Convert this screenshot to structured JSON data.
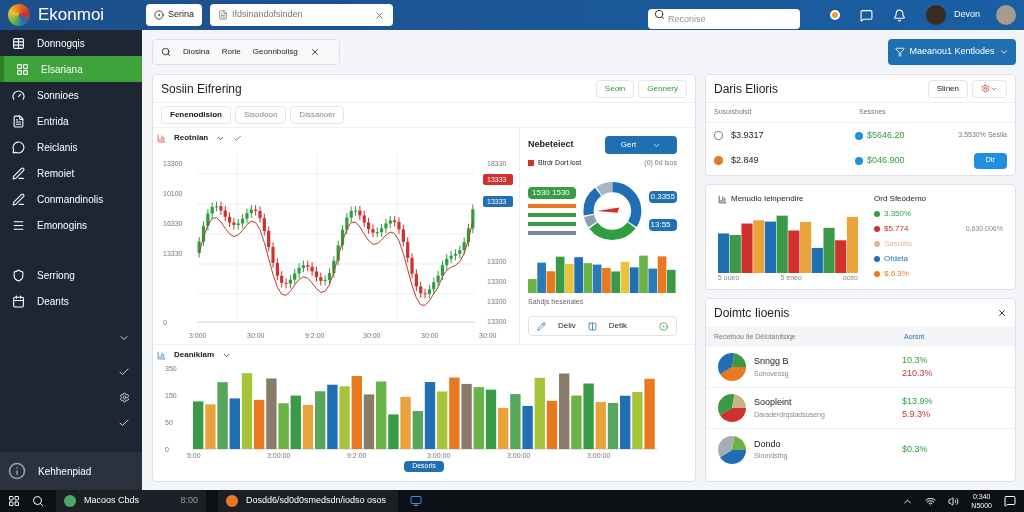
{
  "topbar": {
    "app_name": "Ekonmoi",
    "tab": "Serina",
    "field_value": "Ifdsinandofsinden",
    "search": {
      "placeholder": "Reconise"
    },
    "user": "Devon"
  },
  "sidebar": {
    "items": [
      {
        "label": "Donnogqis",
        "selected": false
      },
      {
        "label": "Elsariana",
        "selected": true
      },
      {
        "label": "Sonnioes",
        "selected": false
      },
      {
        "label": "Entrida",
        "selected": false
      },
      {
        "label": "Reiclanis",
        "selected": false
      },
      {
        "label": "Remoiet",
        "selected": false
      },
      {
        "label": "Conmandinolis",
        "selected": false
      },
      {
        "label": "Emonogins",
        "selected": false
      }
    ],
    "more_items": [
      {
        "label": "Serriong",
        "selected": false
      },
      {
        "label": "Deants",
        "selected": false
      }
    ],
    "footer": "Kehhenpiad"
  },
  "filter_bar": {
    "chips": [
      "Diosina",
      "Rorie",
      "Geonnbolisg"
    ]
  },
  "primary_button": "Maeanou1 Kentlodes",
  "main_card": {
    "title": "Sosiin Eifrering",
    "actions": [
      "Seoin",
      "Gennery"
    ],
    "tabs": [
      {
        "label": "Fenenodision",
        "selected": true
      },
      {
        "label": "Sisodoon",
        "selected": false
      },
      {
        "label": "Dissanoer",
        "selected": false
      }
    ],
    "price_chart": {
      "title": "Reotnlan",
      "left_ticks": [
        "13300",
        "10100",
        "16330",
        "13330",
        "0"
      ],
      "right_ticks": [
        "18330",
        "13300",
        "13300",
        "13300",
        "13300"
      ],
      "tags": [
        "13333",
        "13333"
      ],
      "x_labels": [
        "3:000",
        "30:00",
        "9:2:00",
        "30:00",
        "30:00",
        "30:00"
      ]
    },
    "side_panel": {
      "title": "Nebeteiect",
      "dropdown": "Gert",
      "legend": "Btrdr Dort lost",
      "legend_note": "(0) 0d lsos",
      "pill": "1530 1530",
      "donut_tags": [
        "0.3355",
        "13:55"
      ],
      "axis_note": "Sahdjs besenales",
      "tools": [
        "Deliv",
        "Detik"
      ]
    },
    "volume_chart": {
      "title": "Deaniklam",
      "y_ticks": [
        "350",
        "150",
        "50",
        "0"
      ],
      "x_labels": [
        "5:00",
        "3:00:00",
        "9:2:00",
        "3:00:00",
        "3:00:00",
        "3:00:00"
      ],
      "pill": "Desoris"
    }
  },
  "accounts_card": {
    "title": "Daris Elioris",
    "action": "Slinen",
    "columns": [
      "Susoisbolsit",
      "Sessnes"
    ],
    "rows": [
      {
        "checked": false,
        "amount": "$3.9317",
        "value": "$5646.20",
        "note": "3.5530% Sesila"
      },
      {
        "checked": true,
        "amount": "$2.849",
        "value": "$046.900",
        "button": "Dtr"
      }
    ]
  },
  "breakdown_card": {
    "title": "Menudio Ielnpendire",
    "legend_title": "Ord Sfeodemo",
    "side_note": "0.630.006%",
    "legend": [
      {
        "label": "3.350%",
        "color": "#2e9e3e"
      },
      {
        "label": "$5.774",
        "color": "#d0312d"
      },
      {
        "label": "Sasoitis",
        "color": "#e8b48a"
      },
      {
        "label": "Ofdeta",
        "color": "#1f6fb2"
      },
      {
        "label": "$.6.3%",
        "color": "#e8791f"
      }
    ],
    "x_labels": [
      "5 uueo",
      "5 eneo",
      "oceo"
    ]
  },
  "insights_card": {
    "title": "Doimtc Iioenis",
    "columns": [
      "Recetnou Ile Délotanitslqe",
      "Aorsnt"
    ],
    "rows": [
      {
        "name": "Snngg B",
        "detail": "Sonovessg",
        "up": "10.3%",
        "down": "210.3%"
      },
      {
        "name": "Soopleint",
        "detail": "Daraderdrqsiadsoseng",
        "up": "$13.9%",
        "down": "5.9.3%"
      },
      {
        "name": "Dondo",
        "detail": "Sbondsthg",
        "up": "$0.3%"
      }
    ]
  },
  "taskbar": {
    "apps": [
      {
        "label": "Macoos Cbds",
        "note": "8:00"
      },
      {
        "label": "Dosdd6/sd0d0smedsdn/iodso osos"
      }
    ],
    "clock": [
      "0:340",
      "N5000"
    ]
  }
}
